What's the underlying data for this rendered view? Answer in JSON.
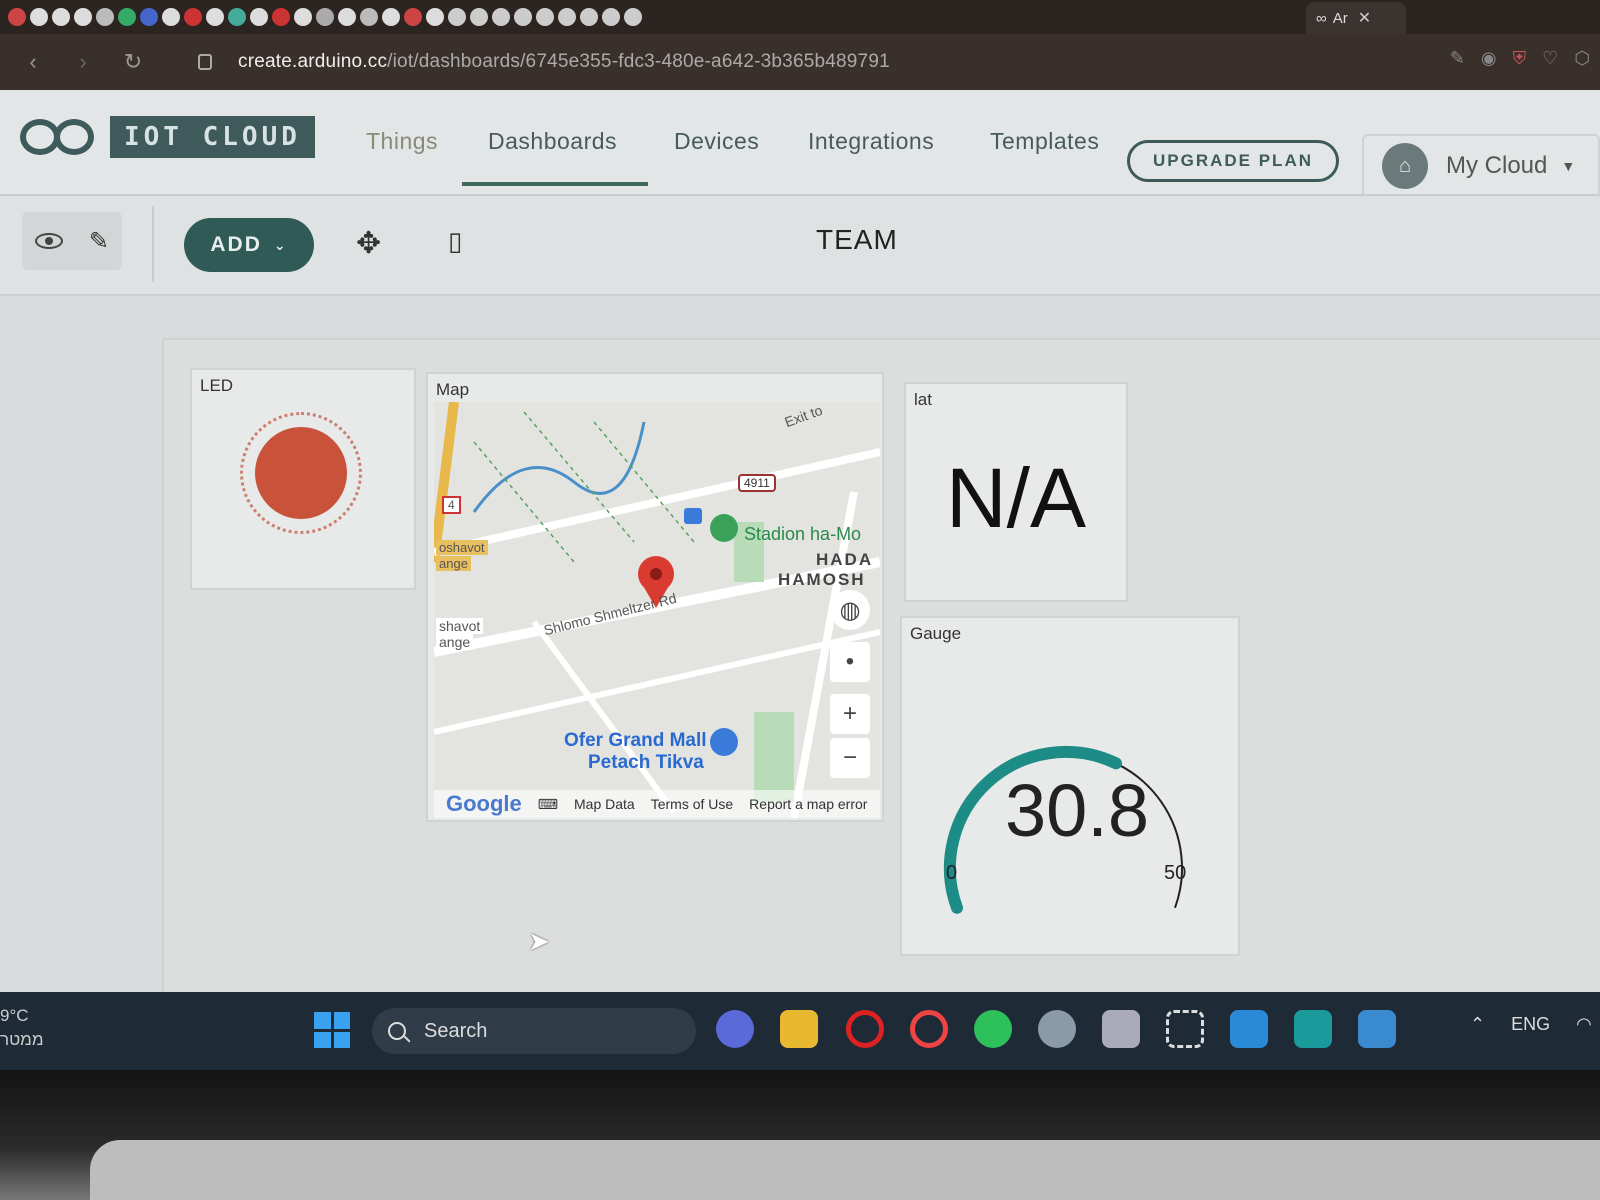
{
  "browser": {
    "active_tab_label": "Ar",
    "url_domain": "create.arduino.cc",
    "url_path": "/iot/dashboards/6745e355-fdc3-480e-a642-3b365b489791"
  },
  "header": {
    "brand": "IOT CLOUD",
    "nav": [
      {
        "label": "Things"
      },
      {
        "label": "Dashboards"
      },
      {
        "label": "Devices"
      },
      {
        "label": "Integrations"
      },
      {
        "label": "Templates"
      }
    ],
    "active_nav": "Dashboards",
    "upgrade_label": "UPGRADE PLAN",
    "account_label": "My Cloud"
  },
  "toolbar": {
    "add_label": "ADD",
    "dashboard_title": "TEAM"
  },
  "widgets": {
    "led": {
      "label": "LED",
      "color": "#c9533a"
    },
    "map": {
      "label": "Map",
      "places": {
        "exit": "Exit to",
        "road_shield": "4911",
        "route": "4",
        "stadium": "Stadion ha-Mo",
        "district_1": "HADA",
        "district_2": "HAMOSH",
        "street": "Shlomo Shmeltzer Rd",
        "area_1": "oshavot",
        "area_2": "ange",
        "area_3": "shavot",
        "area_4": "ange",
        "mall_1": "Ofer Grand Mall",
        "mall_2": "Petach Tikva"
      },
      "footer": {
        "logo": "Google",
        "map_data": "Map Data",
        "terms": "Terms of Use",
        "report": "Report a map error"
      }
    },
    "lat": {
      "label": "lat",
      "value": "N/A"
    },
    "gauge": {
      "label": "Gauge",
      "value": "30.8",
      "min": "0",
      "max": "50",
      "fraction": 0.616,
      "color": "#1e8c86"
    }
  },
  "taskbar": {
    "weather_temp": "9°C",
    "weather_desc": "ממטר",
    "search_placeholder": "Search",
    "language": "ENG"
  }
}
